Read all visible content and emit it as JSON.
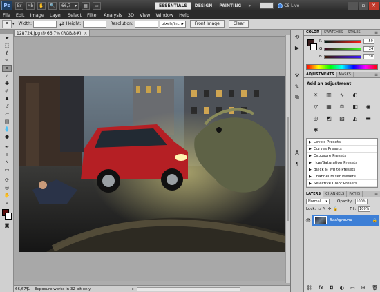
{
  "titlebar": {
    "logo": "Ps",
    "zoom_value": "66,7",
    "workspaces": [
      "ESSENTIALS",
      "DESIGN",
      "PAINTING",
      "»"
    ],
    "cs_live": "CS Live",
    "window_buttons": [
      "–",
      "▫",
      "✕"
    ]
  },
  "menu": [
    "File",
    "Edit",
    "Image",
    "Layer",
    "Select",
    "Filter",
    "Analysis",
    "3D",
    "View",
    "Window",
    "Help"
  ],
  "options": {
    "width_label": "Width:",
    "height_label": "Height:",
    "resolution_label": "Resolution:",
    "unit_value": "pixels/inch",
    "front_image": "Front Image",
    "clear": "Clear"
  },
  "document": {
    "tab_title": "128724.jpg @ 66,7% (RGB/8#)",
    "close": "×"
  },
  "status": {
    "zoom": "66,67%",
    "info": "Exposure works in 32-bit only",
    "arrow": "▸"
  },
  "color_panel": {
    "tabs": [
      "COLOR",
      "SWATCHES",
      "STYLES"
    ],
    "r_label": "R",
    "g_label": "G",
    "b_label": "B",
    "r_value": "59",
    "g_value": "24",
    "b_value": "30",
    "fg_color": "#3b181e"
  },
  "adjustments": {
    "tabs": [
      "ADJUSTMENTS",
      "MASKS"
    ],
    "title": "Add an adjustment",
    "presets": [
      "Levels Presets",
      "Curves Presets",
      "Exposure Presets",
      "Hue/Saturation Presets",
      "Black & White Presets",
      "Channel Mixer Presets",
      "Selective Color Presets"
    ]
  },
  "layers": {
    "tabs": [
      "LAYERS",
      "CHANNELS",
      "PATHS"
    ],
    "blend_mode": "Normal",
    "opacity_label": "Opacity:",
    "opacity_value": "100%",
    "lock_label": "Lock:",
    "fill_label": "Fill:",
    "fill_value": "100%",
    "layer_name": "Background"
  }
}
